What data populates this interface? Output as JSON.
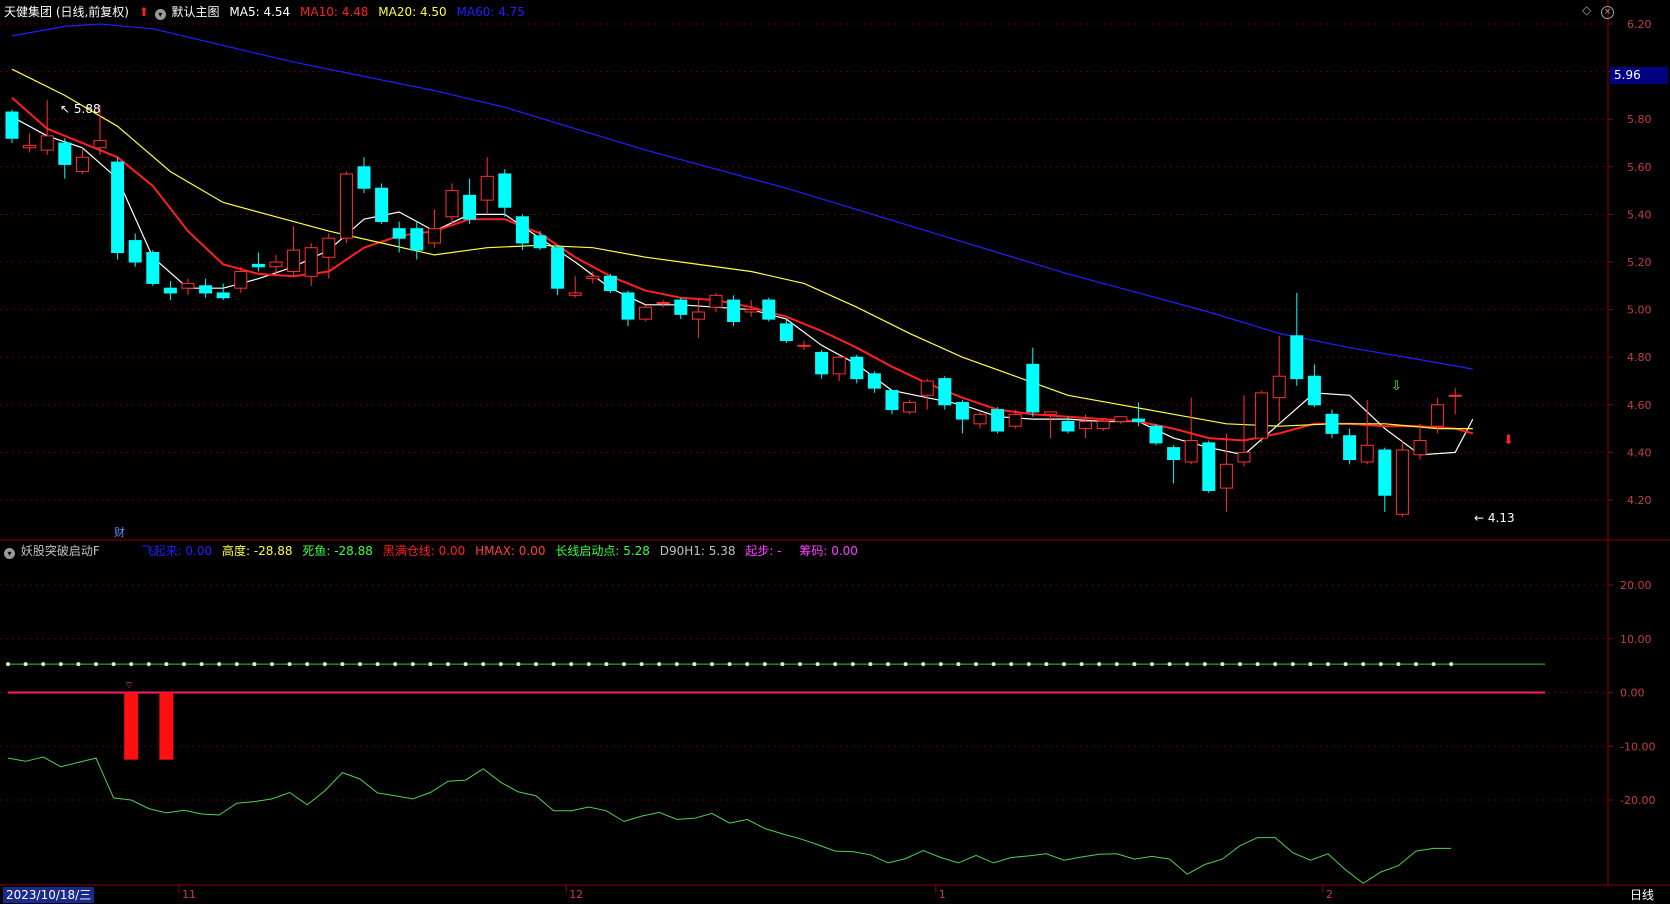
{
  "window": {
    "stock_title": "天健集团 (日线,前复权)",
    "main_chart_label": "默认主图",
    "ma_labels": [
      {
        "label": "MA5: 4.54",
        "color": "#ffffff"
      },
      {
        "label": "MA10: 4.48",
        "color": "#ff2020"
      },
      {
        "label": "MA20: 4.50",
        "color": "#ffff40"
      },
      {
        "label": "MA60: 4.75",
        "color": "#2020ff"
      }
    ],
    "corner_icons": [
      "diamond-icon",
      "close-icon"
    ]
  },
  "indicator": {
    "name": "妖股突破启动F",
    "params": [
      {
        "label": "飞起来: 0.00",
        "color": "#2020ff"
      },
      {
        "label": "高度: -28.88",
        "color": "#ffff40"
      },
      {
        "label": "死鱼: -28.88",
        "color": "#40ff40"
      },
      {
        "label": "黑满仓线: 0.00",
        "color": "#ff2020"
      },
      {
        "label": "HMAX: 0.00",
        "color": "#ff4040"
      },
      {
        "label": "长线启动点: 5.28",
        "color": "#40ff40"
      },
      {
        "label": "D90H1: 5.38",
        "color": "#c0c0c0"
      },
      {
        "label": "起步: -",
        "color": "#ff40ff"
      },
      {
        "label": "筹码: 0.00",
        "color": "#ff40ff"
      }
    ]
  },
  "price_axis": {
    "ticks": [
      "6.20",
      "6.00",
      "5.80",
      "5.60",
      "5.40",
      "5.20",
      "5.00",
      "4.80",
      "4.60",
      "4.40",
      "4.20"
    ],
    "current_price_tag": "5.96",
    "high_label": "5.88",
    "low_label": "4.13",
    "fin_marker": "财"
  },
  "indicator_axis": {
    "ticks": [
      "20.00",
      "10.00",
      "0.00",
      "-10.00",
      "-20.00"
    ]
  },
  "time_axis": {
    "cursor_date": "2023/10/18/三",
    "month_labels": [
      "11",
      "12",
      "1",
      "2"
    ],
    "period_label": "日线"
  },
  "chart_data": {
    "type": "candlestick",
    "up_color": "#ff3030",
    "down_color": "#00ffff",
    "price_range": [
      4.1,
      6.25
    ],
    "candles": [
      {
        "o": 5.83,
        "h": 5.84,
        "l": 5.7,
        "c": 5.72
      },
      {
        "o": 5.68,
        "h": 5.74,
        "l": 5.66,
        "c": 5.69
      },
      {
        "o": 5.67,
        "h": 5.88,
        "l": 5.65,
        "c": 5.73
      },
      {
        "o": 5.7,
        "h": 5.72,
        "l": 5.55,
        "c": 5.61
      },
      {
        "o": 5.58,
        "h": 5.68,
        "l": 5.57,
        "c": 5.64
      },
      {
        "o": 5.68,
        "h": 5.86,
        "l": 5.65,
        "c": 5.71
      },
      {
        "o": 5.62,
        "h": 5.64,
        "l": 5.21,
        "c": 5.24
      },
      {
        "o": 5.29,
        "h": 5.32,
        "l": 5.18,
        "c": 5.2
      },
      {
        "o": 5.24,
        "h": 5.25,
        "l": 5.1,
        "c": 5.11
      },
      {
        "o": 5.09,
        "h": 5.12,
        "l": 5.04,
        "c": 5.07
      },
      {
        "o": 5.09,
        "h": 5.13,
        "l": 5.06,
        "c": 5.11
      },
      {
        "o": 5.1,
        "h": 5.13,
        "l": 5.05,
        "c": 5.07
      },
      {
        "o": 5.07,
        "h": 5.11,
        "l": 5.04,
        "c": 5.05
      },
      {
        "o": 5.09,
        "h": 5.18,
        "l": 5.07,
        "c": 5.16
      },
      {
        "o": 5.19,
        "h": 5.24,
        "l": 5.16,
        "c": 5.18
      },
      {
        "o": 5.18,
        "h": 5.23,
        "l": 5.14,
        "c": 5.2
      },
      {
        "o": 5.16,
        "h": 5.35,
        "l": 5.14,
        "c": 5.25
      },
      {
        "o": 5.14,
        "h": 5.28,
        "l": 5.1,
        "c": 5.26
      },
      {
        "o": 5.22,
        "h": 5.32,
        "l": 5.13,
        "c": 5.3
      },
      {
        "o": 5.3,
        "h": 5.58,
        "l": 5.28,
        "c": 5.57
      },
      {
        "o": 5.6,
        "h": 5.64,
        "l": 5.49,
        "c": 5.51
      },
      {
        "o": 5.51,
        "h": 5.53,
        "l": 5.36,
        "c": 5.37
      },
      {
        "o": 5.34,
        "h": 5.37,
        "l": 5.24,
        "c": 5.3
      },
      {
        "o": 5.34,
        "h": 5.37,
        "l": 5.21,
        "c": 5.25
      },
      {
        "o": 5.28,
        "h": 5.42,
        "l": 5.26,
        "c": 5.34
      },
      {
        "o": 5.39,
        "h": 5.53,
        "l": 5.36,
        "c": 5.5
      },
      {
        "o": 5.48,
        "h": 5.55,
        "l": 5.36,
        "c": 5.38
      },
      {
        "o": 5.46,
        "h": 5.64,
        "l": 5.4,
        "c": 5.56
      },
      {
        "o": 5.57,
        "h": 5.59,
        "l": 5.39,
        "c": 5.43
      },
      {
        "o": 5.39,
        "h": 5.4,
        "l": 5.25,
        "c": 5.28
      },
      {
        "o": 5.31,
        "h": 5.33,
        "l": 5.25,
        "c": 5.26
      },
      {
        "o": 5.26,
        "h": 5.27,
        "l": 5.06,
        "c": 5.09
      },
      {
        "o": 5.06,
        "h": 5.14,
        "l": 5.05,
        "c": 5.07
      },
      {
        "o": 5.13,
        "h": 5.16,
        "l": 5.11,
        "c": 5.14
      },
      {
        "o": 5.14,
        "h": 5.15,
        "l": 5.07,
        "c": 5.08
      },
      {
        "o": 5.07,
        "h": 5.08,
        "l": 4.93,
        "c": 4.96
      },
      {
        "o": 4.96,
        "h": 5.02,
        "l": 4.95,
        "c": 5.01
      },
      {
        "o": 5.03,
        "h": 5.04,
        "l": 5.01,
        "c": 5.03
      },
      {
        "o": 5.04,
        "h": 5.05,
        "l": 4.96,
        "c": 4.98
      },
      {
        "o": 4.96,
        "h": 5.05,
        "l": 4.88,
        "c": 4.99
      },
      {
        "o": 5.01,
        "h": 5.07,
        "l": 4.99,
        "c": 5.06
      },
      {
        "o": 5.04,
        "h": 5.06,
        "l": 4.93,
        "c": 4.95
      },
      {
        "o": 4.99,
        "h": 5.04,
        "l": 4.97,
        "c": 5.0
      },
      {
        "o": 5.04,
        "h": 5.05,
        "l": 4.95,
        "c": 4.96
      },
      {
        "o": 4.94,
        "h": 4.96,
        "l": 4.86,
        "c": 4.87
      },
      {
        "o": 4.85,
        "h": 4.87,
        "l": 4.83,
        "c": 4.85
      },
      {
        "o": 4.82,
        "h": 4.83,
        "l": 4.71,
        "c": 4.73
      },
      {
        "o": 4.73,
        "h": 4.81,
        "l": 4.7,
        "c": 4.8
      },
      {
        "o": 4.8,
        "h": 4.81,
        "l": 4.69,
        "c": 4.71
      },
      {
        "o": 4.73,
        "h": 4.74,
        "l": 4.65,
        "c": 4.67
      },
      {
        "o": 4.66,
        "h": 4.66,
        "l": 4.56,
        "c": 4.58
      },
      {
        "o": 4.57,
        "h": 4.62,
        "l": 4.56,
        "c": 4.61
      },
      {
        "o": 4.64,
        "h": 4.71,
        "l": 4.58,
        "c": 4.7
      },
      {
        "o": 4.71,
        "h": 4.72,
        "l": 4.58,
        "c": 4.6
      },
      {
        "o": 4.61,
        "h": 4.62,
        "l": 4.48,
        "c": 4.54
      },
      {
        "o": 4.52,
        "h": 4.57,
        "l": 4.5,
        "c": 4.56
      },
      {
        "o": 4.58,
        "h": 4.59,
        "l": 4.48,
        "c": 4.49
      },
      {
        "o": 4.51,
        "h": 4.58,
        "l": 4.5,
        "c": 4.56
      },
      {
        "o": 4.77,
        "h": 4.84,
        "l": 4.55,
        "c": 4.57
      },
      {
        "o": 4.56,
        "h": 4.57,
        "l": 4.46,
        "c": 4.57
      },
      {
        "o": 4.53,
        "h": 4.55,
        "l": 4.48,
        "c": 4.49
      },
      {
        "o": 4.5,
        "h": 4.56,
        "l": 4.46,
        "c": 4.53
      },
      {
        "o": 4.5,
        "h": 4.54,
        "l": 4.49,
        "c": 4.53
      },
      {
        "o": 4.53,
        "h": 4.55,
        "l": 4.52,
        "c": 4.55
      },
      {
        "o": 4.54,
        "h": 4.61,
        "l": 4.51,
        "c": 4.53
      },
      {
        "o": 4.51,
        "h": 4.52,
        "l": 4.43,
        "c": 4.44
      },
      {
        "o": 4.42,
        "h": 4.43,
        "l": 4.27,
        "c": 4.37
      },
      {
        "o": 4.36,
        "h": 4.63,
        "l": 4.35,
        "c": 4.45
      },
      {
        "o": 4.44,
        "h": 4.45,
        "l": 4.23,
        "c": 4.24
      },
      {
        "o": 4.25,
        "h": 4.48,
        "l": 4.15,
        "c": 4.35
      },
      {
        "o": 4.36,
        "h": 4.64,
        "l": 4.34,
        "c": 4.4
      },
      {
        "o": 4.46,
        "h": 4.66,
        "l": 4.44,
        "c": 4.65
      },
      {
        "o": 4.63,
        "h": 4.89,
        "l": 4.53,
        "c": 4.72
      },
      {
        "o": 4.89,
        "h": 5.07,
        "l": 4.68,
        "c": 4.71
      },
      {
        "o": 4.72,
        "h": 4.77,
        "l": 4.59,
        "c": 4.6
      },
      {
        "o": 4.56,
        "h": 4.58,
        "l": 4.46,
        "c": 4.48
      },
      {
        "o": 4.47,
        "h": 4.5,
        "l": 4.35,
        "c": 4.37
      },
      {
        "o": 4.36,
        "h": 4.62,
        "l": 4.35,
        "c": 4.43
      },
      {
        "o": 4.41,
        "h": 4.42,
        "l": 4.15,
        "c": 4.22
      },
      {
        "o": 4.14,
        "h": 4.45,
        "l": 4.13,
        "c": 4.41
      },
      {
        "o": 4.39,
        "h": 4.52,
        "l": 4.37,
        "c": 4.45
      },
      {
        "o": 4.51,
        "h": 4.63,
        "l": 4.48,
        "c": 4.6
      },
      {
        "o": 4.64,
        "h": 4.67,
        "l": 4.56,
        "c": 4.64
      }
    ],
    "ma_series": [
      {
        "name": "MA5",
        "color": "#ffffff",
        "points": [
          [
            0,
            5.81
          ],
          [
            2,
            5.73
          ],
          [
            4,
            5.68
          ],
          [
            6,
            5.55
          ],
          [
            8,
            5.22
          ],
          [
            10,
            5.09
          ],
          [
            12,
            5.09
          ],
          [
            14,
            5.13
          ],
          [
            16,
            5.18
          ],
          [
            18,
            5.25
          ],
          [
            20,
            5.38
          ],
          [
            22,
            5.41
          ],
          [
            24,
            5.33
          ],
          [
            26,
            5.4
          ],
          [
            28,
            5.4
          ],
          [
            30,
            5.3
          ],
          [
            32,
            5.2
          ],
          [
            34,
            5.09
          ],
          [
            36,
            5.02
          ],
          [
            38,
            5.02
          ],
          [
            40,
            5.01
          ],
          [
            42,
            5.0
          ],
          [
            44,
            4.96
          ],
          [
            46,
            4.85
          ],
          [
            48,
            4.77
          ],
          [
            50,
            4.66
          ],
          [
            52,
            4.63
          ],
          [
            54,
            4.6
          ],
          [
            56,
            4.55
          ],
          [
            58,
            4.54
          ],
          [
            60,
            4.54
          ],
          [
            62,
            4.53
          ],
          [
            64,
            4.53
          ],
          [
            66,
            4.46
          ],
          [
            68,
            4.42
          ],
          [
            70,
            4.39
          ],
          [
            72,
            4.52
          ],
          [
            74,
            4.65
          ],
          [
            76,
            4.64
          ],
          [
            78,
            4.5
          ],
          [
            80,
            4.39
          ],
          [
            82,
            4.4
          ],
          [
            83,
            4.54
          ]
        ]
      },
      {
        "name": "MA10",
        "color": "#ff2020",
        "points": [
          [
            0,
            5.89
          ],
          [
            2,
            5.76
          ],
          [
            4,
            5.7
          ],
          [
            6,
            5.64
          ],
          [
            8,
            5.52
          ],
          [
            10,
            5.33
          ],
          [
            12,
            5.19
          ],
          [
            14,
            5.15
          ],
          [
            16,
            5.14
          ],
          [
            18,
            5.16
          ],
          [
            20,
            5.26
          ],
          [
            22,
            5.31
          ],
          [
            24,
            5.33
          ],
          [
            26,
            5.38
          ],
          [
            28,
            5.38
          ],
          [
            30,
            5.32
          ],
          [
            32,
            5.22
          ],
          [
            34,
            5.14
          ],
          [
            36,
            5.08
          ],
          [
            38,
            5.05
          ],
          [
            40,
            5.04
          ],
          [
            42,
            5.01
          ],
          [
            44,
            4.97
          ],
          [
            46,
            4.91
          ],
          [
            48,
            4.84
          ],
          [
            50,
            4.76
          ],
          [
            52,
            4.69
          ],
          [
            54,
            4.63
          ],
          [
            56,
            4.58
          ],
          [
            58,
            4.56
          ],
          [
            60,
            4.55
          ],
          [
            62,
            4.54
          ],
          [
            64,
            4.53
          ],
          [
            66,
            4.5
          ],
          [
            68,
            4.46
          ],
          [
            70,
            4.45
          ],
          [
            72,
            4.48
          ],
          [
            74,
            4.52
          ],
          [
            76,
            4.52
          ],
          [
            78,
            4.51
          ],
          [
            80,
            4.51
          ],
          [
            82,
            4.5
          ],
          [
            83,
            4.48
          ]
        ]
      },
      {
        "name": "MA20",
        "color": "#ffff40",
        "points": [
          [
            0,
            6.01
          ],
          [
            3,
            5.9
          ],
          [
            6,
            5.77
          ],
          [
            9,
            5.58
          ],
          [
            12,
            5.45
          ],
          [
            15,
            5.39
          ],
          [
            18,
            5.33
          ],
          [
            21,
            5.28
          ],
          [
            24,
            5.23
          ],
          [
            27,
            5.26
          ],
          [
            30,
            5.27
          ],
          [
            33,
            5.26
          ],
          [
            36,
            5.22
          ],
          [
            39,
            5.19
          ],
          [
            42,
            5.16
          ],
          [
            45,
            5.11
          ],
          [
            48,
            5.01
          ],
          [
            51,
            4.9
          ],
          [
            54,
            4.8
          ],
          [
            57,
            4.72
          ],
          [
            60,
            4.64
          ],
          [
            63,
            4.6
          ],
          [
            66,
            4.56
          ],
          [
            69,
            4.52
          ],
          [
            72,
            4.51
          ],
          [
            75,
            4.52
          ],
          [
            78,
            4.52
          ],
          [
            81,
            4.5
          ],
          [
            83,
            4.5
          ]
        ]
      },
      {
        "name": "MA60",
        "color": "#2020ff",
        "points": [
          [
            0,
            6.15
          ],
          [
            3,
            6.19
          ],
          [
            5,
            6.2
          ],
          [
            8,
            6.18
          ],
          [
            12,
            6.11
          ],
          [
            16,
            6.04
          ],
          [
            20,
            5.98
          ],
          [
            24,
            5.92
          ],
          [
            28,
            5.85
          ],
          [
            32,
            5.76
          ],
          [
            36,
            5.67
          ],
          [
            40,
            5.59
          ],
          [
            44,
            5.51
          ],
          [
            48,
            5.42
          ],
          [
            52,
            5.33
          ],
          [
            56,
            5.24
          ],
          [
            60,
            5.15
          ],
          [
            64,
            5.07
          ],
          [
            68,
            4.99
          ],
          [
            72,
            4.9
          ],
          [
            76,
            4.84
          ],
          [
            80,
            4.79
          ],
          [
            83,
            4.75
          ]
        ]
      }
    ],
    "indicator": {
      "range": [
        -36,
        29
      ],
      "baseline_pink": 0,
      "dotted_green": 5.28,
      "red_bars": [
        {
          "i": 7,
          "v": -12.5
        },
        {
          "i": 9,
          "v": -12.5
        }
      ],
      "green_line": [
        -12.2,
        -12.8,
        -12.0,
        -13.8,
        -13.0,
        -12.2,
        -19.6,
        -20.0,
        -21.6,
        -22.4,
        -21.9,
        -22.6,
        -22.8,
        -20.6,
        -20.3,
        -19.8,
        -18.6,
        -20.9,
        -18.3,
        -14.9,
        -16.1,
        -18.7,
        -19.2,
        -19.8,
        -18.6,
        -16.5,
        -16.3,
        -14.2,
        -16.7,
        -18.5,
        -19.2,
        -22.0,
        -22.0,
        -21.3,
        -22.0,
        -24.0,
        -23.0,
        -22.3,
        -23.6,
        -23.4,
        -22.5,
        -24.3,
        -23.6,
        -25.3,
        -26.3,
        -27.2,
        -28.3,
        -29.5,
        -29.6,
        -30.2,
        -31.7,
        -30.9,
        -29.4,
        -30.7,
        -31.7,
        -30.3,
        -31.7,
        -30.7,
        -30.4,
        -30.0,
        -31.2,
        -30.6,
        -30.1,
        -30.0,
        -31.0,
        -30.5,
        -31.0,
        -33.8,
        -32.0,
        -31.0,
        -28.5,
        -27.0,
        -27.0,
        -29.8,
        -31.2,
        -30.0,
        -33.0,
        -35.5,
        -33.4,
        -32.2,
        -29.5,
        -29.0,
        -29.0
      ]
    }
  }
}
